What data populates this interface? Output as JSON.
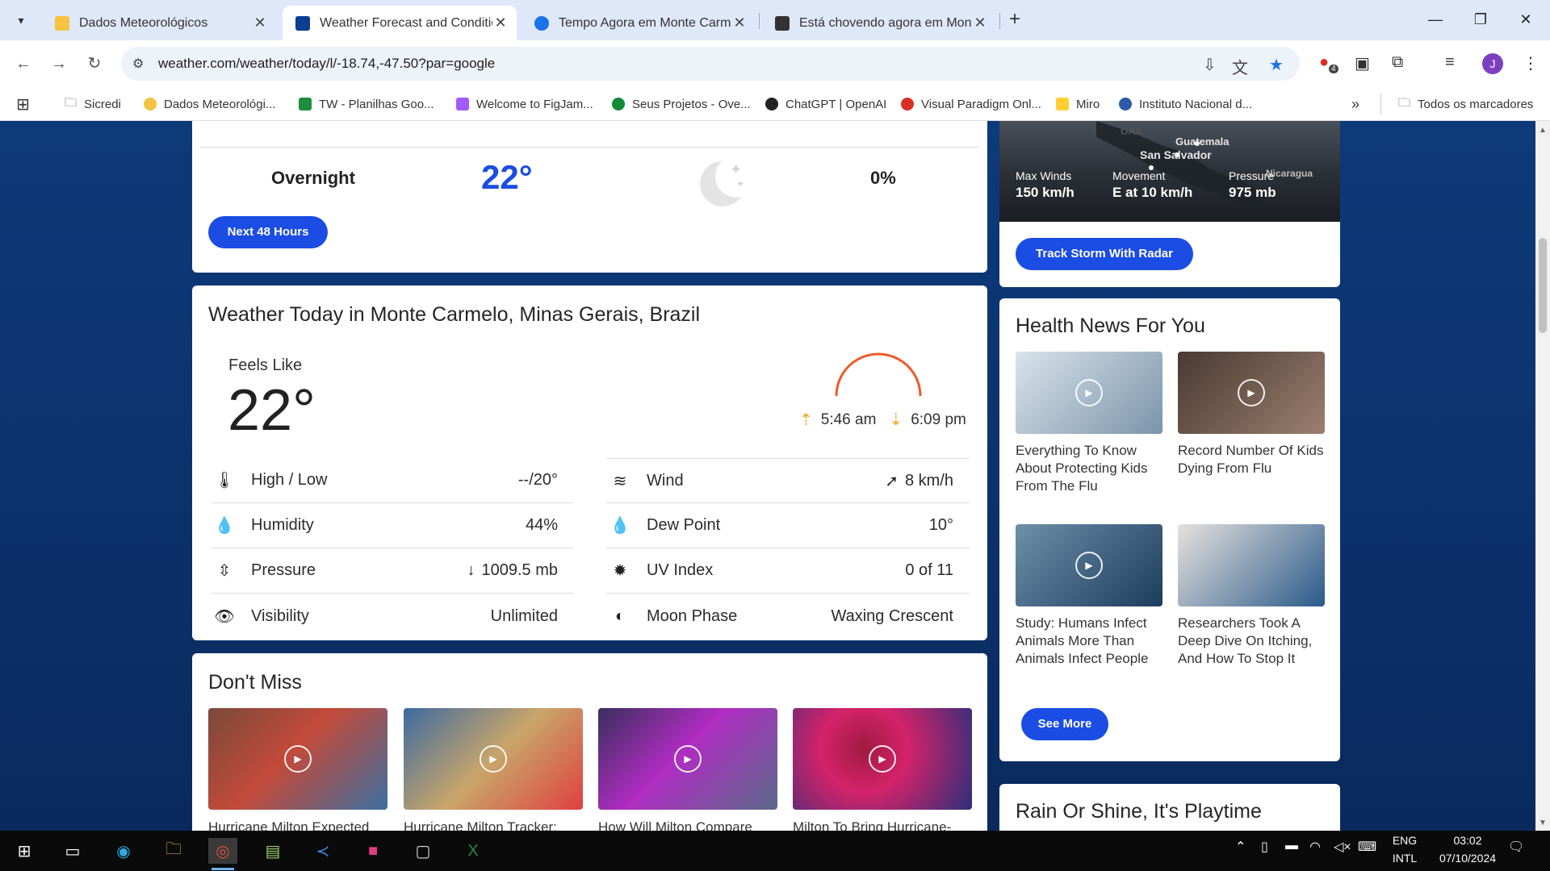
{
  "browser": {
    "tabs": [
      {
        "title": "Dados Meteorológicos",
        "color": "#f5c242",
        "active": false
      },
      {
        "title": "Weather Forecast and Condition",
        "color": "#0b3d91",
        "active": true
      },
      {
        "title": "Tempo Agora em Monte Carme",
        "color": "#1a73e8",
        "active": false
      },
      {
        "title": "Está chovendo agora em Monte",
        "color": "#333333",
        "active": false
      }
    ],
    "url": "weather.com/weather/today/l/-18.74,-47.50?par=google",
    "bookmarks": [
      {
        "label": "Sicredi",
        "icon": "folder-icon",
        "color": "#555555"
      },
      {
        "label": "Dados Meteorológi...",
        "icon": "weather-icon",
        "color": "#f5c242"
      },
      {
        "label": "TW - Planilhas Goo...",
        "icon": "sheets-icon",
        "color": "#1e8e3e"
      },
      {
        "label": "Welcome to FigJam...",
        "icon": "figma-icon",
        "color": "#a259ff"
      },
      {
        "label": "Seus Projetos - Ove...",
        "icon": "overleaf-icon",
        "color": "#138a36"
      },
      {
        "label": "ChatGPT | OpenAI",
        "icon": "openai-icon",
        "color": "#222222"
      },
      {
        "label": "Visual Paradigm Onl...",
        "icon": "vp-icon",
        "color": "#d93025"
      },
      {
        "label": "Miro",
        "icon": "miro-icon",
        "color": "#ffd02f"
      },
      {
        "label": "Instituto Nacional d...",
        "icon": "inmet-icon",
        "color": "#2d5aa8"
      }
    ],
    "all_bookmarks_label": "Todos os marcadores",
    "profile_initial": "J",
    "extensions_badge": "4"
  },
  "hourly": {
    "row_label": "Overnight",
    "row_temp": "22°",
    "row_precip": "0%",
    "next_button": "Next 48 Hours"
  },
  "storm": {
    "map_labels": [
      "OAX.",
      "Guatemala",
      "San Salvador",
      "Nicaragua"
    ],
    "stats": [
      {
        "label": "Max Winds",
        "value": "150 km/h"
      },
      {
        "label": "Movement",
        "value": "E at 10 km/h"
      },
      {
        "label": "Pressure",
        "value": "975 mb"
      }
    ],
    "button": "Track Storm With Radar"
  },
  "today": {
    "heading": "Weather Today in Monte Carmelo, Minas Gerais, Brazil",
    "feels_like_label": "Feels Like",
    "feels_like_value": "22°",
    "sunrise": "5:46 am",
    "sunset": "6:09 pm",
    "details_left": [
      {
        "label": "High / Low",
        "value": "--/20°",
        "icon": "thermometer-icon"
      },
      {
        "label": "Humidity",
        "value": "44%",
        "icon": "drop-icon"
      },
      {
        "label": "Pressure",
        "value": "1009.5 mb",
        "icon": "pressure-icon",
        "prefix": "↓"
      },
      {
        "label": "Visibility",
        "value": "Unlimited",
        "icon": "eye-icon"
      }
    ],
    "details_right": [
      {
        "label": "Wind",
        "value": "8 km/h",
        "icon": "wind-icon",
        "prefix": "➚"
      },
      {
        "label": "Dew Point",
        "value": "10°",
        "icon": "dewpoint-icon"
      },
      {
        "label": "UV Index",
        "value": "0 of 11",
        "icon": "uv-icon"
      },
      {
        "label": "Moon Phase",
        "value": "Waxing Crescent",
        "icon": "moon-icon"
      }
    ]
  },
  "dont_miss": {
    "heading": "Don't Miss",
    "items": [
      {
        "title": "Hurricane Milton Expected",
        "colors": [
          "#7a4a3a",
          "#c44a3a",
          "#3b6fa0"
        ]
      },
      {
        "title": "Hurricane Milton Tracker:",
        "colors": [
          "#3d6aa0",
          "#c9a56a",
          "#e04040"
        ]
      },
      {
        "title": "How Will Milton Compare",
        "colors": [
          "#3a2f5e",
          "#b02cc2",
          "#5a6a8a"
        ]
      },
      {
        "title": "Milton To Bring Hurricane-",
        "colors": [
          "#2b2f7a",
          "#d4236a",
          "#a01a40"
        ]
      }
    ]
  },
  "health": {
    "heading": "Health News For You",
    "items": [
      {
        "title": "Everything To Know About Protecting Kids From The Flu",
        "colors": [
          "#d9e3ea",
          "#7a94ab"
        ]
      },
      {
        "title": "Record Number Of Kids Dying From Flu",
        "colors": [
          "#4a3a32",
          "#9b7f6e"
        ]
      },
      {
        "title": "Study: Humans Infect Animals More Than Animals Infect People",
        "colors": [
          "#6d8fa8",
          "#1d3d5e"
        ]
      },
      {
        "title": "Researchers Took A Deep Dive On Itching, And How To Stop It",
        "colors": [
          "#e6e2de",
          "#2b5a8a"
        ]
      }
    ],
    "see_more": "See More"
  },
  "playtime_heading": "Rain Or Shine, It's Playtime",
  "taskbar": {
    "lang_line1": "ENG",
    "lang_line2": "INTL",
    "time": "03:02",
    "date": "07/10/2024"
  }
}
